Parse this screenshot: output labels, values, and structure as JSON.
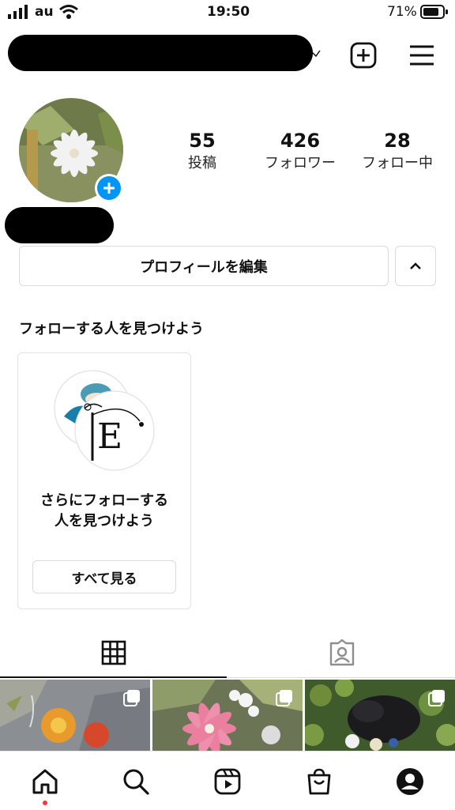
{
  "status_bar": {
    "carrier": "au",
    "time": "19:50",
    "battery": "71%"
  },
  "header": {
    "username": "",
    "icons": [
      "plus-square-icon",
      "menu-icon"
    ]
  },
  "profile": {
    "stats": [
      {
        "value": "55",
        "label": "投稿"
      },
      {
        "value": "426",
        "label": "フォロワー"
      },
      {
        "value": "28",
        "label": "フォロー中"
      }
    ],
    "edit_profile_label": "プロフィールを編集"
  },
  "discover": {
    "title": "フォローする人を見つけよう",
    "card_text_line1": "さらにフォローする",
    "card_text_line2": "人を見つけよう",
    "see_all_label": "すべて見る"
  },
  "tabs": [
    "grid-icon",
    "tagged-icon"
  ],
  "bottom_nav": [
    "home-icon",
    "search-icon",
    "reels-icon",
    "shop-icon",
    "profile-icon"
  ],
  "colors": {
    "accent_blue": "#0095f6",
    "notification_red": "#ff3040",
    "border": "#dbdbdb"
  }
}
